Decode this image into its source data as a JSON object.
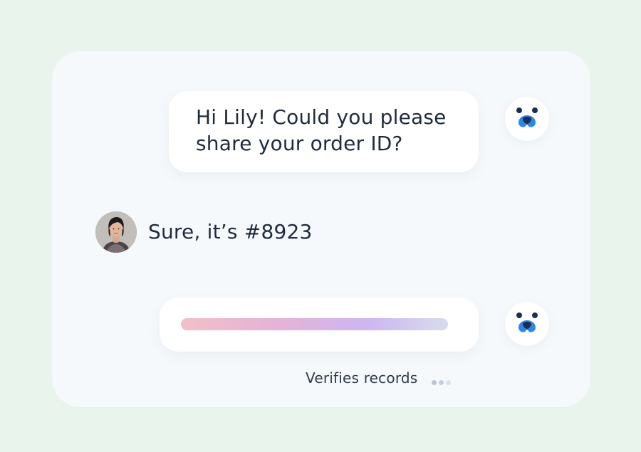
{
  "conversation": {
    "agent_message_1": "Hi Lily! Could you please share your order ID?",
    "user_message": "Sure, it’s #8923",
    "status_text": "Verifies records",
    "progress_fraction": 1.0
  },
  "icons": {
    "agent_avatar": "dog-face-icon",
    "user_avatar": "user-photo",
    "typing": "typing-dots-icon"
  },
  "colors": {
    "background": "#e9f5ec",
    "card": "#f6f9fc",
    "text": "#1f2b3d",
    "brand_blue": "#2f86e6",
    "brand_dark": "#1b2e54",
    "progress_gradient": [
      "#f3bfc8",
      "#e5b3d6",
      "#cdb6f2",
      "#d7dcec"
    ]
  }
}
